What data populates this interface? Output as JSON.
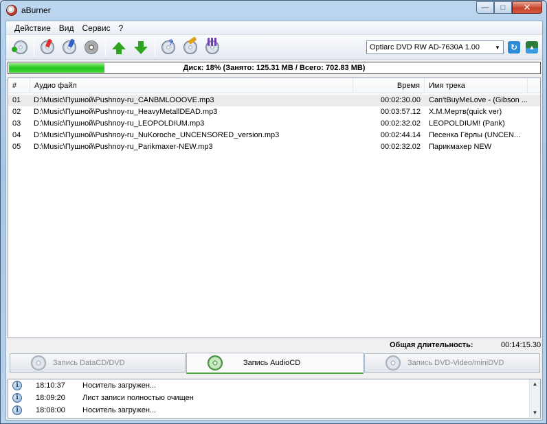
{
  "window": {
    "title": "aBurner"
  },
  "menu": [
    "Действие",
    "Вид",
    "Сервис",
    "?"
  ],
  "toolbar": {
    "icons": [
      "add-disc-icon",
      "burn-disc-icon",
      "write-disc-icon",
      "erase-disc-icon",
      "move-up-icon",
      "move-down-icon",
      "disc-info-icon",
      "clean-disc-icon",
      "settings-icon"
    ],
    "drive": "Optiarc DVD RW AD-7630A 1.00",
    "refresh_color": "#2e8bd6",
    "eject_color": "#2b7b3a"
  },
  "progress": {
    "fraction": 0.18,
    "text": "Диск: 18% (Занято: 125.31 MB / Всего: 702.83 MB)",
    "color": "#25c61b"
  },
  "list": {
    "headers": {
      "num": "#",
      "file": "Аудио файл",
      "time": "Время",
      "track": "Имя трека"
    },
    "rows": [
      {
        "num": "01",
        "file": "D:\\Music\\Пушной\\Pushnoy-ru_CANBMLOOOVE.mp3",
        "time": "00:02:30.00",
        "track": "Can'tBuyMeLove - (Gibson ...",
        "selected": true
      },
      {
        "num": "02",
        "file": "D:\\Music\\Пушной\\Pushnoy-ru_HeavyMetallDEAD.mp3",
        "time": "00:03:57.12",
        "track": "Х.М.Мертв(quick ver)"
      },
      {
        "num": "03",
        "file": "D:\\Music\\Пушной\\Pushnoy-ru_LEOPOLDIUM.mp3",
        "time": "00:02:32.02",
        "track": "LEOPOLDIUM! (Pank)"
      },
      {
        "num": "04",
        "file": "D:\\Music\\Пушной\\Pushnoy-ru_NuKoroche_UNCENSORED_version.mp3",
        "time": "00:02:44.14",
        "track": "Песенка Гёрлы  (UNCEN..."
      },
      {
        "num": "05",
        "file": "D:\\Music\\Пушной\\Pushnoy-ru_Parikmaxer-NEW.mp3",
        "time": "00:02:32.02",
        "track": "Парикмахер NEW"
      }
    ]
  },
  "total": {
    "label": "Общая длительность:",
    "value": "00:14:15.30"
  },
  "tabs": [
    {
      "label": "Запись DataCD/DVD",
      "active": false
    },
    {
      "label": "Запись AudioCD",
      "active": true
    },
    {
      "label": "Запись DVD-Video/miniDVD",
      "active": false
    }
  ],
  "log": [
    {
      "time": "18:10:37",
      "message": "Носитель загружен..."
    },
    {
      "time": "18:09:20",
      "message": "Лист записи полностью очищен"
    },
    {
      "time": "18:08:00",
      "message": "Носитель загружен..."
    }
  ]
}
